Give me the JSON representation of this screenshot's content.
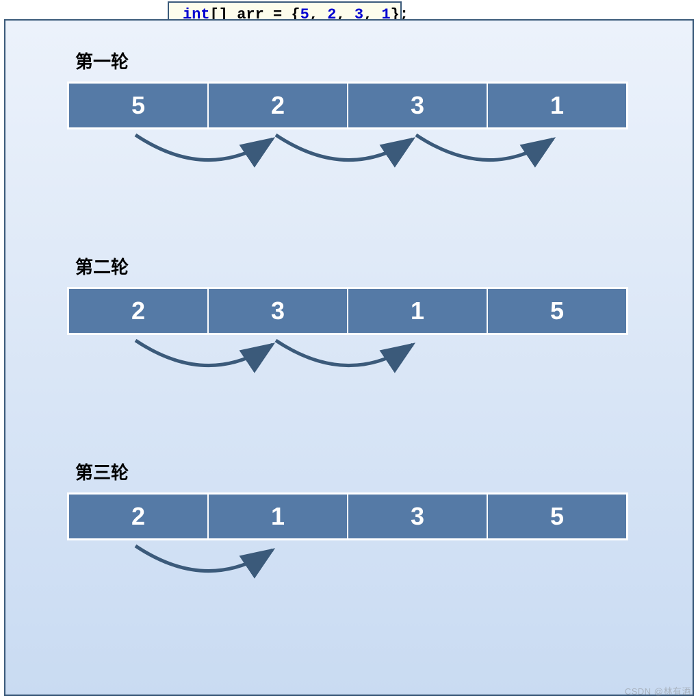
{
  "code": {
    "type_kw": "int",
    "brackets": "[]",
    "var": " arr = {",
    "vals": [
      "5",
      "2",
      "3",
      "1"
    ],
    "sep": ", ",
    "end": "};"
  },
  "rounds": [
    {
      "label": "第一轮",
      "cells": [
        "5",
        "2",
        "3",
        "1"
      ],
      "arrows": 3
    },
    {
      "label": "第二轮",
      "cells": [
        "2",
        "3",
        "1",
        "5"
      ],
      "arrows": 2
    },
    {
      "label": "第三轮",
      "cells": [
        "2",
        "1",
        "3",
        "5"
      ],
      "arrows": 1
    }
  ],
  "colors": {
    "cell_bg": "#557aa6",
    "border": "#3b5a7a",
    "code_bg": "#fdfdec",
    "arrow": "#3b5a7a"
  },
  "watermark": "CSDN @林有酒",
  "chart_data": {
    "type": "table",
    "title": "Bubble sort rounds for int[] arr = {5,2,3,1}",
    "initial_array": [
      5,
      2,
      3,
      1
    ],
    "series": [
      {
        "name": "第一轮",
        "values": [
          5,
          2,
          3,
          1
        ],
        "swaps": 3
      },
      {
        "name": "第二轮",
        "values": [
          2,
          3,
          1,
          5
        ],
        "swaps": 2
      },
      {
        "name": "第三轮",
        "values": [
          2,
          1,
          3,
          5
        ],
        "swaps": 1
      }
    ]
  }
}
